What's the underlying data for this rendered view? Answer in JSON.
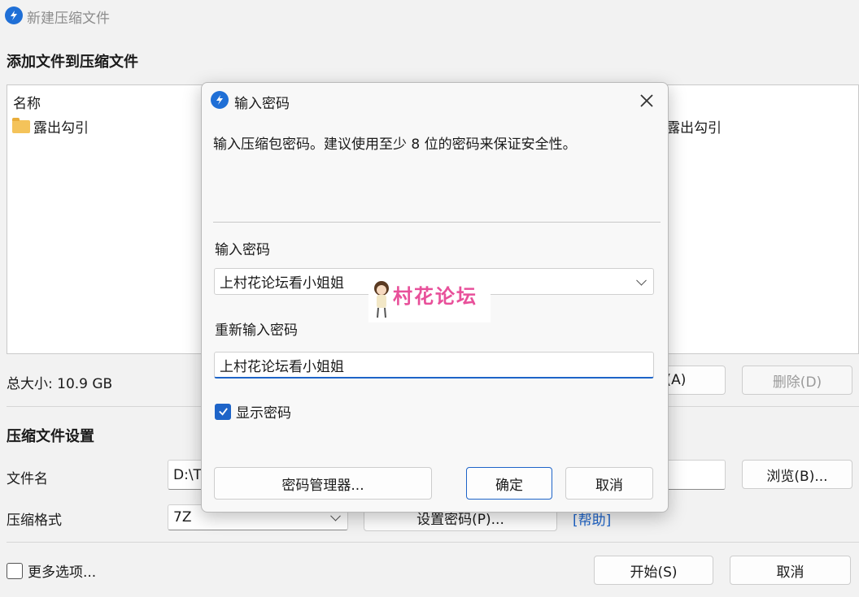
{
  "window": {
    "title": "新建压缩文件"
  },
  "add_section": {
    "heading": "添加文件到压缩文件",
    "column_name": "名称",
    "items": [
      {
        "name": "露出勾引"
      }
    ],
    "right_item": "露出勾引",
    "total_size": "总大小: 10.9 GB",
    "add_button": "(A)",
    "delete_button": "删除(D)"
  },
  "settings": {
    "heading": "压缩文件设置",
    "filename_label": "文件名",
    "filename_value": "D:\\T",
    "browse_button": "浏览(B)...",
    "format_label": "压缩格式",
    "format_value": "7Z",
    "set_password_button": "设置密码(P)...",
    "help_link": "[帮助]"
  },
  "footer": {
    "more_options": "更多选项...",
    "start_button": "开始(S)",
    "cancel_button": "取消"
  },
  "dialog": {
    "title": "输入密码",
    "description": "输入压缩包密码。建议使用至少 8 位的密码来保证安全性。",
    "password_label": "输入密码",
    "password_value": "上村花论坛看小姐姐",
    "reenter_label": "重新输入密码",
    "reenter_value": "上村花论坛看小姐姐",
    "show_password": "显示密码",
    "show_password_checked": true,
    "manager_button": "密码管理器...",
    "ok_button": "确定",
    "cancel_button": "取消"
  },
  "watermark": {
    "text": "村花论坛"
  },
  "colors": {
    "accent": "#1e64c8",
    "watermark": "#e8509a"
  }
}
